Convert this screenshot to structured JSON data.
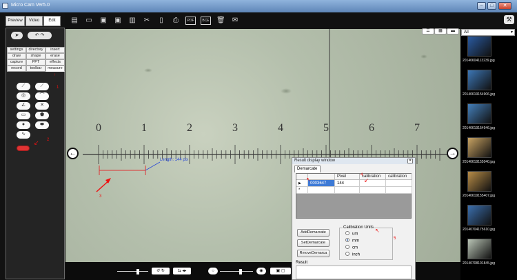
{
  "window": {
    "title": "Micro Cam Ver5.0"
  },
  "mode_tabs": [
    "Preview",
    "Video",
    "Edit"
  ],
  "menu_grid": [
    [
      "settings",
      "directory",
      "insert"
    ],
    [
      "draw",
      "shape",
      "erase"
    ],
    [
      "capture",
      "PPT",
      "effects"
    ],
    [
      "record",
      "toolbar",
      "measure"
    ]
  ],
  "annotations": {
    "a1": "1",
    "a2": "2",
    "a3": "3",
    "a4": "4",
    "a5": "5"
  },
  "ruler": {
    "labels": [
      "0",
      "1",
      "2",
      "3",
      "4",
      "5",
      "6",
      "7"
    ],
    "measurement": "Length: 144 pix"
  },
  "file_filter": {
    "value": "All"
  },
  "thumbnails": [
    {
      "label": "20140604113239.jpg",
      "color": "#2a5aa0"
    },
    {
      "label": "20140619154906.jpg",
      "color": "#3c76b5"
    },
    {
      "label": "20140619154946.jpg",
      "color": "#447fba"
    },
    {
      "label": "20140619155040.jpg",
      "color": "#c7a262"
    },
    {
      "label": "20140619155407.jpg",
      "color": "#b88c47"
    },
    {
      "label": "20140704175610.jpg",
      "color": "#3b6fae"
    },
    {
      "label": "20140708101845.jpg",
      "color": "#b9c4b5"
    }
  ],
  "result_window": {
    "title": "Result display window",
    "tab": "Demarcate",
    "columns": [
      "",
      "Pixel",
      "calibration",
      "calibration"
    ],
    "rows": [
      {
        "id": "0003647",
        "pixel": "144"
      }
    ],
    "buttons": {
      "add": "AddDemarcate",
      "set": "SetDemarcate",
      "remove": "RmoveDemarca"
    },
    "calibration_units": {
      "label": "Calibration Units",
      "options": [
        "um",
        "mm",
        "cm",
        "inch"
      ],
      "selected": "mm"
    },
    "result_label": "Result"
  },
  "toolbar_text": {
    "pdf": "PDF",
    "bcp": "BCE"
  }
}
